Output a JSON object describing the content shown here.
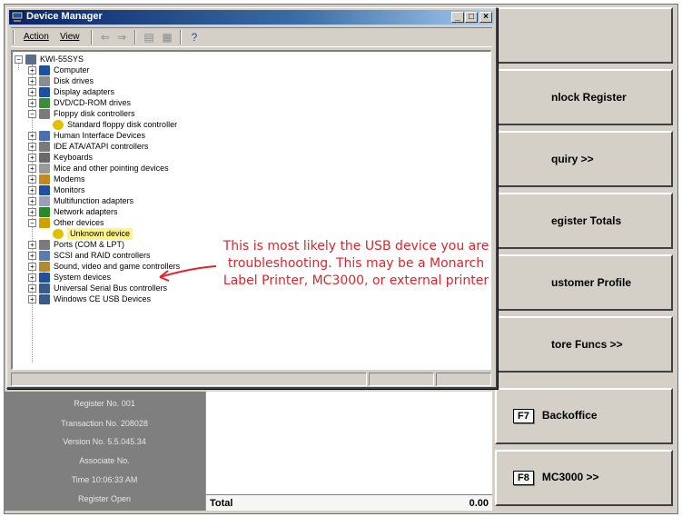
{
  "window": {
    "title": "Device Manager",
    "menu": {
      "action": "Action",
      "view": "View"
    }
  },
  "tree": {
    "root": "KWI-55SYS",
    "items": [
      {
        "label": "Computer",
        "icon": "computer-icon",
        "color": "#1e4fa0"
      },
      {
        "label": "Disk drives",
        "icon": "disk-drive-icon",
        "color": "#8c8c8c"
      },
      {
        "label": "Display adapters",
        "icon": "display-adapter-icon",
        "color": "#1e4fa0"
      },
      {
        "label": "DVD/CD-ROM drives",
        "icon": "cdrom-icon",
        "color": "#3c8c3c"
      },
      {
        "label": "Floppy disk controllers",
        "icon": "floppy-controller-icon",
        "color": "#7a7a7a",
        "expanded": true,
        "children": [
          {
            "label": "Standard floppy disk controller",
            "icon": "warning-device-icon",
            "color": "#e0c000"
          }
        ]
      },
      {
        "label": "Human Interface Devices",
        "icon": "hid-icon",
        "color": "#4a6fb0"
      },
      {
        "label": "IDE ATA/ATAPI controllers",
        "icon": "ide-controller-icon",
        "color": "#7a7a7a"
      },
      {
        "label": "Keyboards",
        "icon": "keyboard-icon",
        "color": "#6a6a6a"
      },
      {
        "label": "Mice and other pointing devices",
        "icon": "mouse-icon",
        "color": "#9a9a9a"
      },
      {
        "label": "Modems",
        "icon": "modem-icon",
        "color": "#c08a20"
      },
      {
        "label": "Monitors",
        "icon": "monitor-icon",
        "color": "#1e4fa0"
      },
      {
        "label": "Multifunction adapters",
        "icon": "multifunction-icon",
        "color": "#9aa0b8"
      },
      {
        "label": "Network adapters",
        "icon": "network-adapter-icon",
        "color": "#2a8a2a"
      },
      {
        "label": "Other devices",
        "icon": "question-icon",
        "color": "#d0a000",
        "expanded": true,
        "children": [
          {
            "label": "Unknown device",
            "icon": "warning-device-icon",
            "color": "#e0c000",
            "selected": true
          }
        ]
      },
      {
        "label": "Ports (COM & LPT)",
        "icon": "port-icon",
        "color": "#7a7a7a"
      },
      {
        "label": "SCSI and RAID controllers",
        "icon": "scsi-icon",
        "color": "#5a7ab0"
      },
      {
        "label": "Sound, video and game controllers",
        "icon": "sound-icon",
        "color": "#b08a30"
      },
      {
        "label": "System devices",
        "icon": "system-device-icon",
        "color": "#1e4fa0"
      },
      {
        "label": "Universal Serial Bus controllers",
        "icon": "usb-icon",
        "color": "#3a5a8a"
      },
      {
        "label": "Windows CE USB Devices",
        "icon": "usb-icon",
        "color": "#3a5a8a"
      }
    ]
  },
  "annotation": {
    "text": "This is most likely the USB device you are troubleshooting.  This may be a Monarch Label Printer, MC3000, or external printer",
    "color": "#e0242b"
  },
  "functions": [
    {
      "label": ""
    },
    {
      "label": "nlock Register"
    },
    {
      "label": "quiry >>"
    },
    {
      "label": "egister Totals"
    },
    {
      "label": "ustomer Profile"
    },
    {
      "label": "tore Funcs >>"
    },
    {
      "key": "F7",
      "label": "Backoffice"
    },
    {
      "key": "F8",
      "label": "MC3000 >>"
    }
  ],
  "register_info": {
    "register": "Register No. 001",
    "transaction": "Transaction No. 208028",
    "version": "Version No. 5.5.045.34",
    "associate": "Associate No.",
    "time": "Time 10:06:33 AM",
    "status": "Register Open"
  },
  "transaction": {
    "total_label": "Total",
    "total_value": "0.00"
  }
}
